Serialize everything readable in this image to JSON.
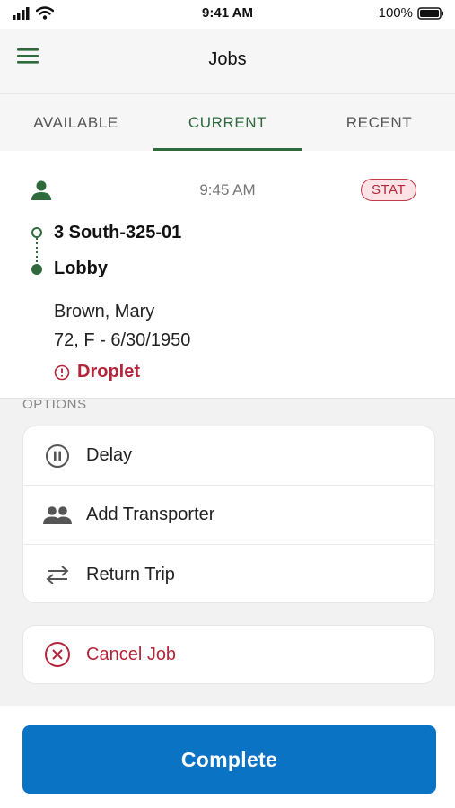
{
  "status_bar": {
    "time": "9:41 AM",
    "battery": "100%"
  },
  "header": {
    "title": "Jobs",
    "menu_icon": "hamburger-menu-icon"
  },
  "tabs": [
    {
      "label": "AVAILABLE",
      "active": false
    },
    {
      "label": "CURRENT",
      "active": true
    },
    {
      "label": "RECENT",
      "active": false
    }
  ],
  "job": {
    "time": "9:45 AM",
    "priority": "STAT",
    "from": "3 South-325-01",
    "to": "Lobby",
    "patient_name": "Brown, Mary",
    "patient_info": "72, F - 6/30/1950",
    "isolation": "Droplet"
  },
  "options": {
    "label": "OPTIONS",
    "items": [
      {
        "label": "Delay",
        "icon": "pause-circle-icon"
      },
      {
        "label": "Add Transporter",
        "icon": "people-icon"
      },
      {
        "label": "Return Trip",
        "icon": "swap-arrows-icon"
      }
    ],
    "cancel": {
      "label": "Cancel Job",
      "icon": "cancel-circle-icon"
    }
  },
  "footer": {
    "complete_label": "Complete"
  },
  "colors": {
    "accent_green": "#2e6a3c",
    "alert_red": "#b3263a",
    "primary_blue": "#0a73c4"
  }
}
